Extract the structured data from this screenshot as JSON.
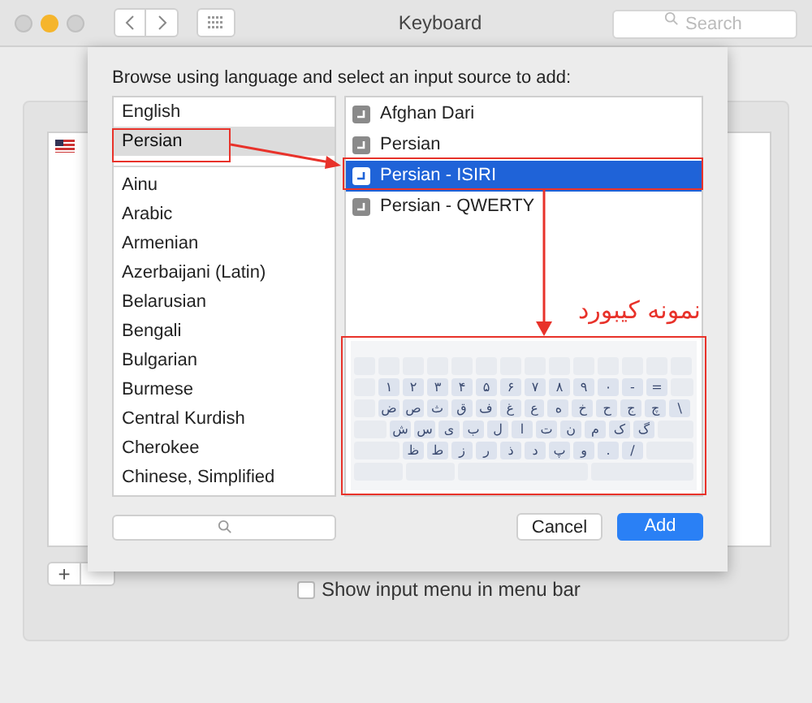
{
  "window": {
    "title": "Keyboard",
    "search": {
      "placeholder": "Search"
    }
  },
  "background": {
    "add_button": "+",
    "show_menu": {
      "label": "Show input menu in menu bar",
      "checked": false
    }
  },
  "dialog": {
    "prompt": "Browse using language and select an input source to add:",
    "languages": [
      {
        "label": "English",
        "selected": false,
        "kind": "preferred"
      },
      {
        "label": "Persian",
        "selected": true,
        "kind": "preferred"
      },
      {
        "label": "Ainu",
        "selected": false,
        "kind": "other"
      },
      {
        "label": "Arabic",
        "selected": false,
        "kind": "other"
      },
      {
        "label": "Armenian",
        "selected": false,
        "kind": "other"
      },
      {
        "label": "Azerbaijani (Latin)",
        "selected": false,
        "kind": "other"
      },
      {
        "label": "Belarusian",
        "selected": false,
        "kind": "other"
      },
      {
        "label": "Bengali",
        "selected": false,
        "kind": "other"
      },
      {
        "label": "Bulgarian",
        "selected": false,
        "kind": "other"
      },
      {
        "label": "Burmese",
        "selected": false,
        "kind": "other"
      },
      {
        "label": "Central Kurdish",
        "selected": false,
        "kind": "other"
      },
      {
        "label": "Cherokee",
        "selected": false,
        "kind": "other"
      },
      {
        "label": "Chinese, Simplified",
        "selected": false,
        "kind": "other"
      }
    ],
    "sources": [
      {
        "label": "Afghan Dari",
        "selected": false
      },
      {
        "label": "Persian",
        "selected": false
      },
      {
        "label": "Persian - ISIRI",
        "selected": true
      },
      {
        "label": "Persian - QWERTY",
        "selected": false
      }
    ],
    "keyboard_rows": [
      [
        "=",
        "-",
        "۰",
        "۹",
        "۸",
        "۷",
        "۶",
        "۵",
        "۴",
        "۳",
        "۲",
        "۱"
      ],
      [
        "\\",
        "چ",
        "ج",
        "ح",
        "خ",
        "ه",
        "ع",
        "غ",
        "ف",
        "ق",
        "ث",
        "ص",
        "ض"
      ],
      [
        "گ",
        "ک",
        "م",
        "ن",
        "ت",
        "ا",
        "ل",
        "ب",
        "ی",
        "س",
        "ش"
      ],
      [
        "/",
        ".",
        "و",
        "پ",
        "د",
        "ذ",
        "ر",
        "ز",
        "ط",
        "ظ"
      ]
    ],
    "buttons": [
      "Cancel",
      "Add"
    ]
  },
  "annotation": {
    "label": "نمونه کیبورد"
  }
}
